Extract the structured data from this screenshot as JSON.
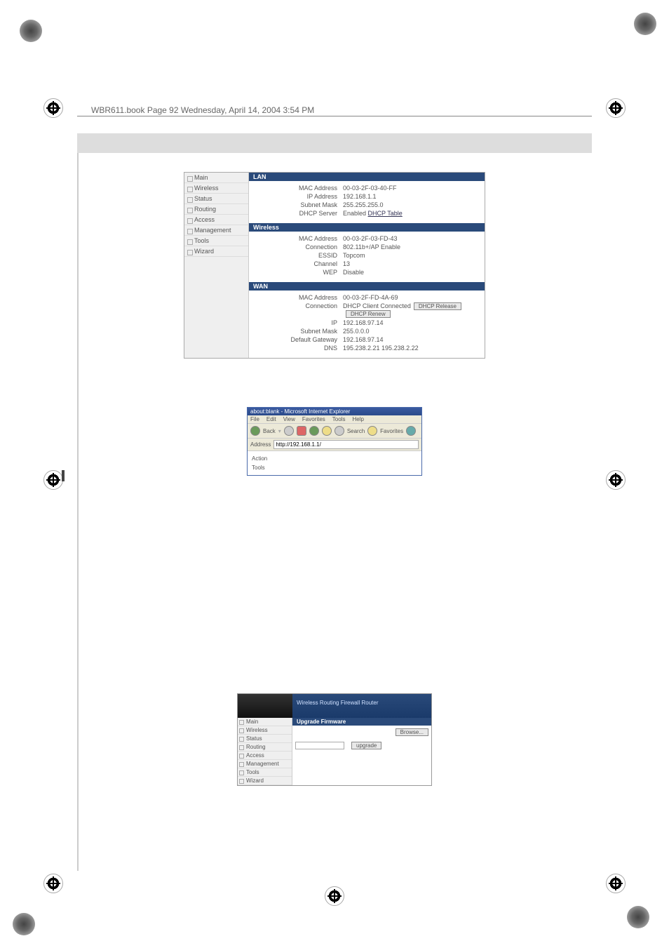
{
  "header": "WBR611.book  Page 92  Wednesday, April 14, 2004  3:54 PM",
  "nav": {
    "items": [
      "Main",
      "Wireless",
      "Status",
      "Routing",
      "Access",
      "Management",
      "Tools",
      "Wizard"
    ]
  },
  "lan": {
    "title": "LAN",
    "mac_k": "MAC Address",
    "mac_v": "00-03-2F-03-40-FF",
    "ip_k": "IP Address",
    "ip_v": "192.168.1.1",
    "subnet_k": "Subnet Mask",
    "subnet_v": "255.255.255.0",
    "dhcp_k": "DHCP Server",
    "dhcp_v": "Enabled",
    "dhcp_link": "DHCP Table"
  },
  "wireless": {
    "title": "Wireless",
    "mac_k": "MAC Address",
    "mac_v": "00-03-2F-03-FD-43",
    "conn_k": "Connection",
    "conn_v": "802.11b+/AP Enable",
    "ssid_k": "ESSID",
    "ssid_v": "Topcom",
    "chan_k": "Channel",
    "chan_v": "13",
    "wep_k": "WEP",
    "wep_v": "Disable"
  },
  "wan": {
    "title": "WAN",
    "mac_k": "MAC Address",
    "mac_v": "00-03-2F-FD-4A-69",
    "conn_k": "Connection",
    "conn_v": "DHCP Client Connected",
    "btn_release": "DHCP Release",
    "btn_renew": "DHCP Renew",
    "ip_k": "IP",
    "ip_v": "192.168.97.14",
    "subnet_k": "Subnet Mask",
    "subnet_v": "255.0.0.0",
    "gw_k": "Default Gateway",
    "gw_v": "192.168.97.14",
    "dns_k": "DNS",
    "dns_v": "195.238.2.21  195.238.2.22"
  },
  "ie": {
    "title": "about:blank - Microsoft Internet Explorer",
    "menu": [
      "File",
      "Edit",
      "View",
      "Favorites",
      "Tools",
      "Help"
    ],
    "back": "Back",
    "search": "Search",
    "favorites": "Favorites",
    "addr_label": "Address",
    "addr_value": "http://192.168.1.1/",
    "body_action": "Action",
    "body_tools": "Tools"
  },
  "fw": {
    "banner": "Wireless  Routing  Firewall  Router",
    "title": "Upgrade Firmware",
    "browse": "Browse...",
    "upgrade": "upgrade",
    "nav": [
      "Main",
      "Wireless",
      "Status",
      "Routing",
      "Access",
      "Management",
      "Tools",
      "Wizard"
    ]
  }
}
